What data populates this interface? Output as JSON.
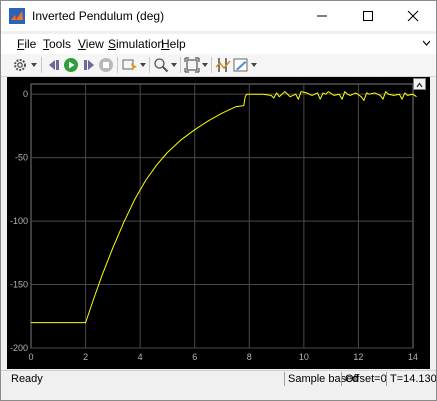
{
  "window": {
    "title": "Inverted Pendulum (deg)",
    "accent": "#d95319"
  },
  "menu": [
    {
      "label": "File",
      "key": "F",
      "rest": "ile"
    },
    {
      "label": "Tools",
      "key": "T",
      "rest": "ools"
    },
    {
      "label": "View",
      "key": "V",
      "rest": "iew"
    },
    {
      "label": "Simulation",
      "key": "S",
      "rest": "imulation"
    },
    {
      "label": "Help",
      "key": "H",
      "rest": "elp"
    }
  ],
  "toolbar": {
    "icons": [
      "settings-icon",
      "step-back-icon",
      "run-icon",
      "step-forward-icon",
      "stop-icon",
      "highlight-icon",
      "zoom-icon",
      "zoom-to-fit-icon",
      "cursor-measurements-icon",
      "style-icon"
    ]
  },
  "plot": {
    "background": "#000000",
    "grid_color": "#4a4a4a",
    "line_color": "#ffff00",
    "xticks": [
      "0",
      "2",
      "4",
      "6",
      "8",
      "10",
      "12",
      "14"
    ],
    "yticks": [
      "0",
      "-50",
      "-100",
      "-150",
      "-200"
    ]
  },
  "chart_data": {
    "type": "line",
    "title": "",
    "xlabel": "",
    "ylabel": "",
    "xlim": [
      0,
      14.13
    ],
    "ylim": [
      -200,
      8
    ],
    "grid": true,
    "legend": "none",
    "series": [
      {
        "color": "#ffff00",
        "x": [
          0,
          2.0,
          2.3,
          2.6,
          3.0,
          3.4,
          3.8,
          4.2,
          4.6,
          5.0,
          5.5,
          6.0,
          6.5,
          7.0,
          7.5,
          7.8,
          7.85,
          7.9,
          8.2,
          8.5,
          8.8,
          8.9,
          9.0,
          9.1,
          9.2,
          9.3,
          9.5,
          9.7,
          9.8,
          9.9,
          10.1,
          10.3,
          10.5,
          10.6,
          10.7,
          10.8,
          10.9,
          11.1,
          11.3,
          11.4,
          11.5,
          11.6,
          11.7,
          11.9,
          12.1,
          12.2,
          12.3,
          12.4,
          12.6,
          12.8,
          12.9,
          13.0,
          13.1,
          13.3,
          13.5,
          13.6,
          13.7,
          13.8,
          14.0,
          14.13
        ],
        "y": [
          -180,
          -180,
          -161,
          -143,
          -121,
          -101,
          -83,
          -68,
          -56,
          -46,
          -36,
          -28,
          -21,
          -15,
          -10,
          -9,
          -2,
          0,
          0,
          0,
          -1,
          -3,
          1,
          -2,
          0,
          2,
          -2,
          0,
          -4,
          2,
          1,
          -1,
          1,
          -4,
          1,
          0,
          2,
          -1,
          0,
          -4,
          2,
          0,
          -1,
          1,
          -2,
          -5,
          1,
          0,
          1,
          -1,
          -4,
          2,
          0,
          -1,
          0,
          -4,
          1,
          -1,
          0,
          -2
        ]
      }
    ]
  },
  "status": {
    "ready": "Ready",
    "sample": "Sample based",
    "offset": "Offset=0",
    "time": "T=14.130"
  }
}
